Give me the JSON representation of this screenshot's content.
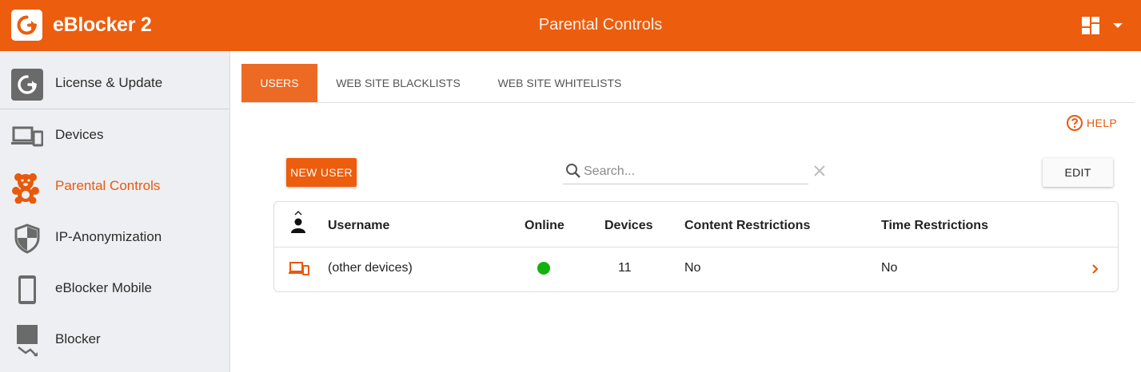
{
  "app": {
    "title": "eBlocker 2",
    "page_title": "Parental Controls"
  },
  "colors": {
    "brand": "#ec5d0d",
    "online": "#11b20e",
    "sidebar_bg": "#eeeff2"
  },
  "sidebar": {
    "items": [
      {
        "label": "License & Update",
        "icon": "license-update-icon",
        "active": false
      },
      {
        "label": "Devices",
        "icon": "devices-icon",
        "active": false
      },
      {
        "label": "Parental Controls",
        "icon": "teddy-bear-icon",
        "active": true
      },
      {
        "label": "IP-Anonymization",
        "icon": "shield-icon",
        "active": false
      },
      {
        "label": "eBlocker Mobile",
        "icon": "mobile-phone-icon",
        "active": false
      },
      {
        "label": "Blocker",
        "icon": "blocker-icon",
        "active": false
      }
    ]
  },
  "tabs": [
    {
      "label": "USERS",
      "active": true
    },
    {
      "label": "WEB SITE BLACKLISTS",
      "active": false
    },
    {
      "label": "WEB SITE WHITELISTS",
      "active": false
    }
  ],
  "help": {
    "label": "HELP"
  },
  "toolbar": {
    "new_user_label": "NEW USER",
    "edit_label": "EDIT",
    "search_placeholder": "Search..."
  },
  "table": {
    "columns": [
      "Username",
      "Online",
      "Devices",
      "Content Restrictions",
      "Time Restrictions"
    ],
    "rows": [
      {
        "icon": "devices-icon",
        "username": "(other devices)",
        "online": true,
        "devices": "11",
        "content_restrictions": "No",
        "time_restrictions": "No"
      }
    ]
  }
}
